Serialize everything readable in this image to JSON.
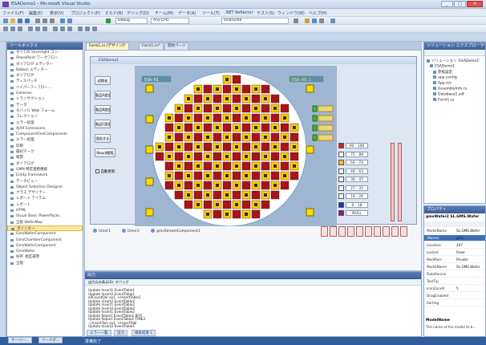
{
  "window": {
    "title": "ESADemo1 - Microsoft Visual Studio",
    "min": "_",
    "max": "□",
    "close": "✕"
  },
  "menu": [
    "ファイル(F)",
    "編集(E)",
    "表示(V)",
    "プロジェクト(P)",
    "ビルド(B)",
    "デバッグ(D)",
    "チーム(M)",
    "データ(A)",
    "ツール(T)",
    ".NET Reflector",
    "テスト(S)",
    "ウィンドウ(W)",
    "ヘルプ(H)"
  ],
  "toolbar": {
    "config": "Debug",
    "platform": "Any CPU",
    "search": "locBrush0"
  },
  "toolbox": {
    "title": "ツールボックス",
    "items": [
      {
        "label": "すべての Silverlight コン..."
      },
      {
        "label": "SharePoint ワークフロー"
      },
      {
        "label": "ダイアログ エディター"
      },
      {
        "label": "Ribbon エディター"
      },
      {
        "label": "ダイアログ"
      },
      {
        "label": "ディスパッチ"
      },
      {
        "label": "ハイパーフーフロー..."
      },
      {
        "label": "Galleries"
      },
      {
        "label": "トランザクション"
      },
      {
        "label": "データ"
      },
      {
        "label": "モバイル Web フォーム"
      },
      {
        "label": "コレクション"
      },
      {
        "label": "エラー処理"
      },
      {
        "label": "AJAX Extensions"
      },
      {
        "label": "ComponentOneComponents"
      },
      {
        "label": "エラー処理"
      },
      {
        "label": "印刷"
      },
      {
        "label": "最初マーク"
      },
      {
        "label": "帳票"
      },
      {
        "label": "ダイアログ"
      },
      {
        "label": "GMN 特定連携機能"
      },
      {
        "label": "Entity Framework"
      },
      {
        "label": "データビュー"
      },
      {
        "label": "Object Selection Designer"
      },
      {
        "label": "クラス デザイナー"
      },
      {
        "label": "レポート アイテム"
      },
      {
        "label": "レポート"
      },
      {
        "label": "HTML"
      },
      {
        "label": "Visual Basic PowerPacks"
      },
      {
        "label": "全般 WaferMap"
      },
      {
        "label": "ポインター",
        "selected": true
      },
      {
        "label": "GmsWaferComponent"
      },
      {
        "label": "GmsChamberComponent"
      },
      {
        "label": "GmsWaferComponent"
      },
      {
        "label": "GmsWafer"
      },
      {
        "label": "WPF 相互運用"
      },
      {
        "label": "全般"
      }
    ]
  },
  "tabs": [
    {
      "label": "Form1.cs [デザイン]*",
      "active": true
    },
    {
      "label": "Form1.cs*"
    },
    {
      "label": "開始ページ"
    }
  ],
  "form": {
    "title": "ESADemo1",
    "buttons": [
      "初期化",
      "製品A設定",
      "製品B設定",
      "製品C設定",
      "保存する",
      "Result閲覧"
    ],
    "checkbox": "自動更新",
    "header_badge": "ESA-R1",
    "header_text": "ESA-V0.1"
  },
  "legend": {
    "ranges": [
      "90 - 100",
      "75 - 89",
      "64 - 74",
      "48 - 63",
      "36 - 47",
      "27 - 35",
      "19 - 26",
      "0 - 18",
      "NULL"
    ],
    "colors": [
      "#d92020",
      "#ffffff",
      "#f0c020",
      "#ffffff",
      "#ffffff",
      "#ffffff",
      "#ffffff",
      "#2030c0",
      "#8020a0"
    ]
  },
  "tray": [
    "timer1",
    "timer2",
    "gmsStreamComponent1"
  ],
  "output": {
    "title": "出力",
    "source_label": "出力元の表示(S): デバッグ",
    "lines": [
      "Update Insert1 EventTable1",
      "Update Insert2 EventTable1",
      "allCountQer ex1 ->InsertTable1",
      "Update Insert2 EventTable2",
      "Update Insert1 EventTable2",
      "Update Insert4 EventTable2",
      "Update Insert1 EventTable2",
      "Update Report EventTable1 BCR",
      "Update Report EventTable1 TIME2",
      "->InsertTwo ex1 ->InsertTabl",
      "Update Insert2 EventTable1"
    ],
    "tabs": [
      "エラー一覧",
      "出力",
      "検索結果 1"
    ]
  },
  "solution": {
    "title": "ソリューション エクスプローラー",
    "items": [
      "ソリューション 'ESADemo1'",
      "ESADemo1",
      "参照設定",
      "app.config",
      "App.ico",
      "AssemblyInfo.cs",
      "Database1.sdf",
      "Form1.cs"
    ]
  },
  "properties": {
    "title": "プロパティ",
    "object": "gmsWafer2 SL.GMS.Wafer",
    "rows": [
      {
        "k": "ModelName",
        "v": "SL.GMS.Wafer"
      },
      {
        "k": "(Name)",
        "v": "gms",
        "selected": true
      },
      {
        "k": "Location",
        "v": "207"
      },
      {
        "k": "Locked",
        "v": "False"
      },
      {
        "k": "Modifiers",
        "v": "Private"
      },
      {
        "k": "ModelName",
        "v": "SL.GMS.Wafer"
      },
      {
        "k": "DataSource",
        "v": ""
      },
      {
        "k": "TextTip",
        "v": ""
      },
      {
        "k": "IconZoneX",
        "v": "5"
      },
      {
        "k": "DragEnabled",
        "v": ""
      },
      {
        "k": "Sorting",
        "v": ""
      }
    ],
    "desc_title": "ModelName",
    "desc_text": "The name of the model to b..."
  },
  "status": {
    "text": "準備完了",
    "bottom_tabs": [
      "サーバー...",
      "ツールボ...",
      "ソリュー...",
      "プロパ..."
    ]
  },
  "colors": {
    "cell_red": "#a8141a",
    "cell_yellow": "#f5d000",
    "cell_dark": "#3a2a0c",
    "wafer_bg": "#c8d8ea",
    "tray_yellow": "#f6dd00"
  }
}
